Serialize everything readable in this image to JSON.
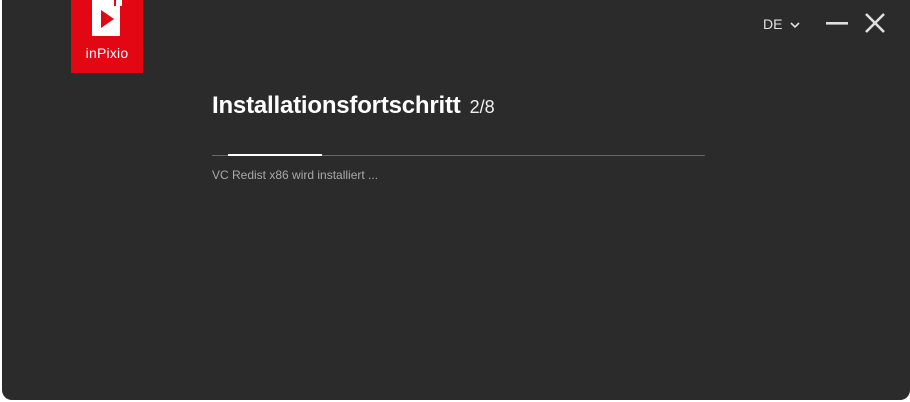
{
  "app": {
    "logo_text": "inPixio",
    "brand_color": "#e30613"
  },
  "header": {
    "language": "DE",
    "icons": {
      "language_dropdown": "chevron-down-icon",
      "minimize": "minimize-icon",
      "close": "close-icon"
    }
  },
  "main": {
    "title": "Installationsfortschritt",
    "step": "2/8",
    "progress_percent": 19,
    "status": "VC Redist x86 wird installiert ..."
  }
}
